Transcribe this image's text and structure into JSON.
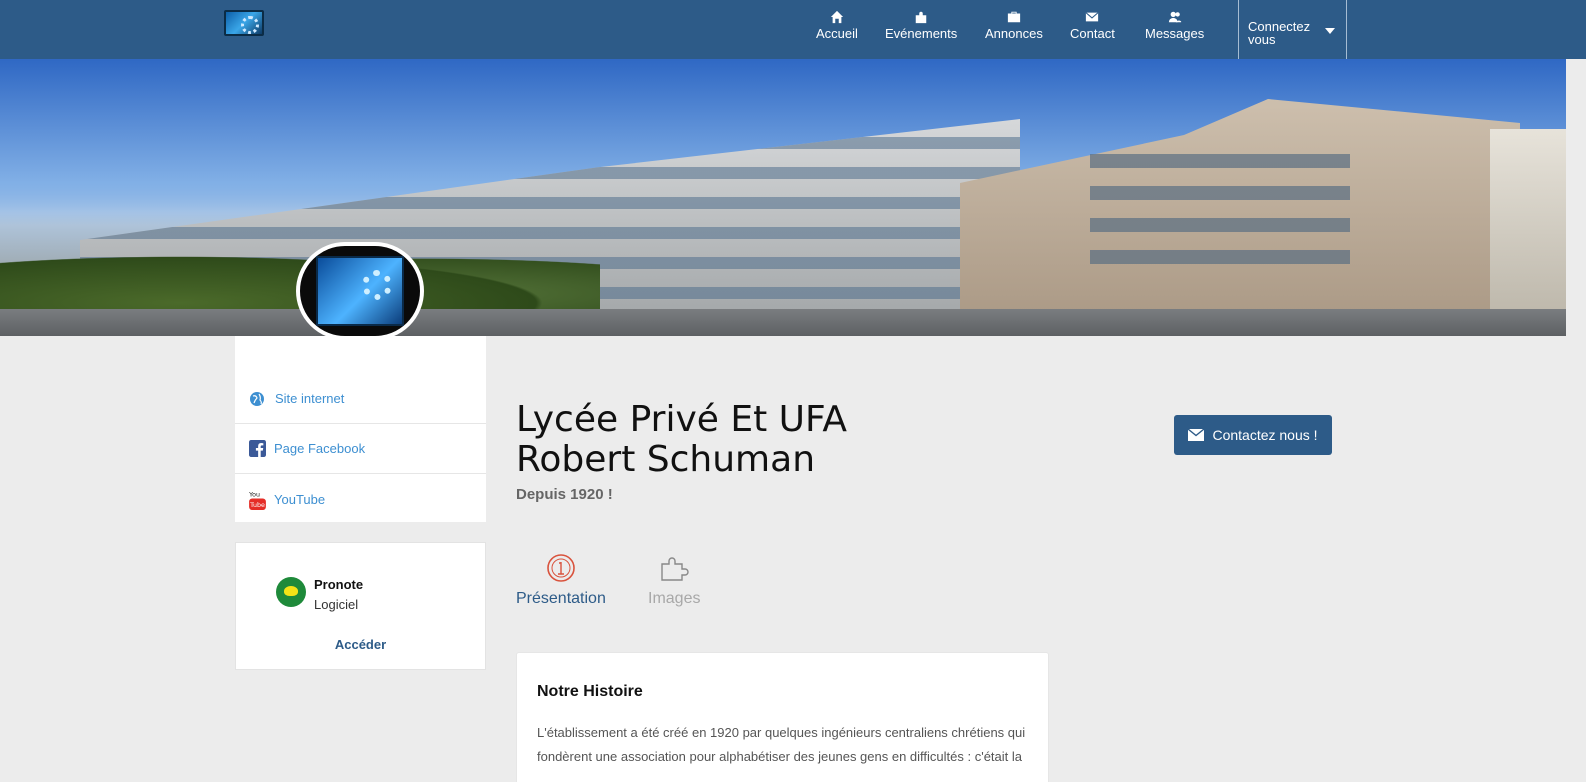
{
  "nav": {
    "items": [
      {
        "label": "Accueil",
        "icon": "home-icon"
      },
      {
        "label": "Evénements",
        "icon": "puzzle-icon"
      },
      {
        "label": "Annonces",
        "icon": "briefcase-icon"
      },
      {
        "label": "Contact",
        "icon": "envelope-icon"
      },
      {
        "label": "Messages",
        "icon": "users-icon"
      }
    ],
    "connect_line1": "Connectez",
    "connect_line2": "vous"
  },
  "links": [
    {
      "label": "Site internet",
      "icon": "globe-icon"
    },
    {
      "label": "Page Facebook",
      "icon": "facebook-icon"
    },
    {
      "label": "YouTube",
      "icon": "youtube-icon"
    }
  ],
  "pronote": {
    "name": "Pronote",
    "type": "Logiciel",
    "action": "Accéder"
  },
  "school": {
    "title": "Lycée Privé Et UFA Robert Schuman",
    "subtitle": "Depuis 1920 !",
    "contact_label": "Contactez nous !"
  },
  "tabs": [
    {
      "label": "Présentation",
      "icon": "info-icon",
      "active": true
    },
    {
      "label": "Images",
      "icon": "puzzle-icon",
      "active": false
    }
  ],
  "history": {
    "title": "Notre Histoire",
    "text": "L'établissement a été créé en 1920 par quelques ingénieurs centraliens chrétiens qui fondèrent une association pour alphabétiser des jeunes gens en difficultés : c'était la"
  },
  "colors": {
    "primary": "#2d5b88",
    "link": "#3d8fd1",
    "background": "#ececec"
  }
}
